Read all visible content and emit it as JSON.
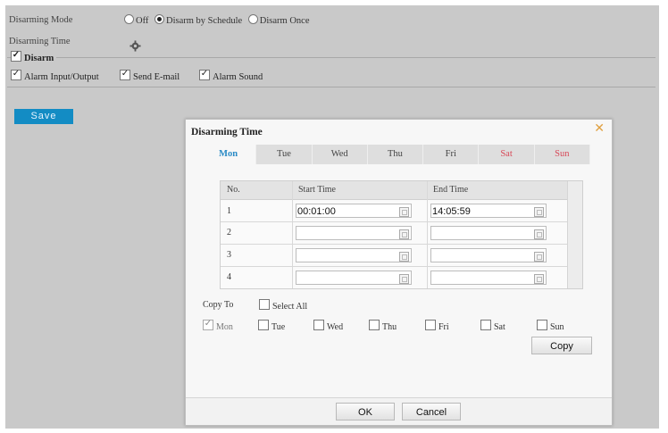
{
  "form": {
    "mode_label": "Disarming Mode",
    "mode_options": [
      "Off",
      "Disarm by Schedule",
      "Disarm Once"
    ],
    "time_label": "Disarming Time",
    "disarm_group_label": "Disarm",
    "disarm_items": [
      "Alarm Input/Output",
      "Send E-mail",
      "Alarm Sound"
    ],
    "save_label": "Save"
  },
  "dialog": {
    "title": "Disarming Time",
    "close_icon": "close-icon",
    "tabs": [
      "Mon",
      "Tue",
      "Wed",
      "Thu",
      "Fri",
      "Sat",
      "Sun"
    ],
    "table": {
      "headers": [
        "No.",
        "Start Time",
        "End Time"
      ],
      "rows": [
        {
          "no": "1",
          "start": "00:01:00",
          "end": "14:05:59"
        },
        {
          "no": "2",
          "start": "",
          "end": ""
        },
        {
          "no": "3",
          "start": "",
          "end": ""
        },
        {
          "no": "4",
          "start": "",
          "end": ""
        }
      ]
    },
    "copy_to_label": "Copy To",
    "select_all_label": "Select All",
    "copy_days": [
      "Mon",
      "Tue",
      "Wed",
      "Thu",
      "Fri",
      "Sat",
      "Sun"
    ],
    "copy_button": "Copy",
    "ok_button": "OK",
    "cancel_button": "Cancel"
  },
  "colors": {
    "accent": "#138cc4",
    "weekend": "#d84b5a",
    "close": "#e0a040"
  }
}
